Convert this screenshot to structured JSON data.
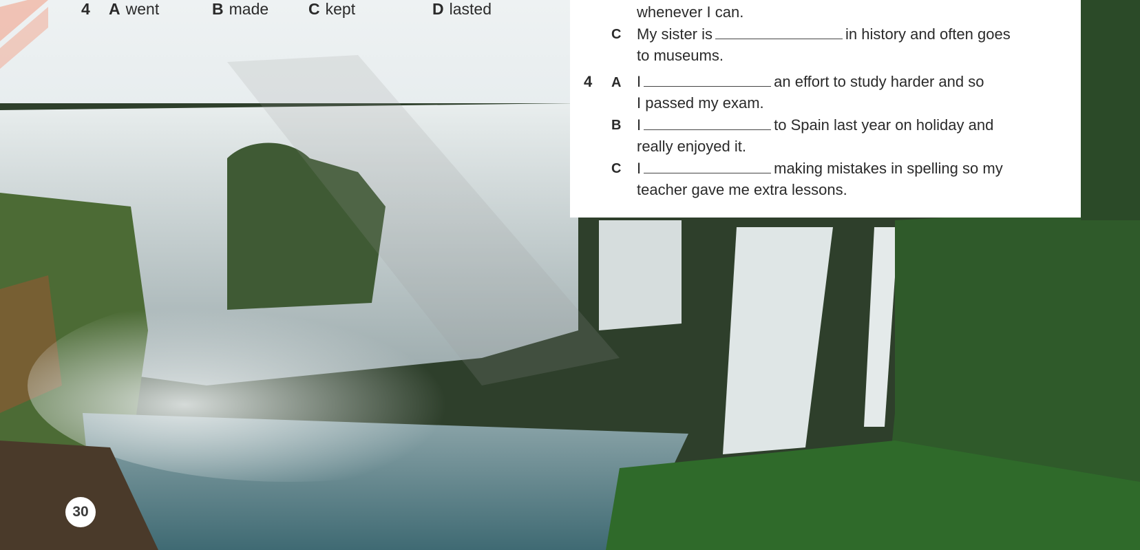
{
  "top_question": {
    "number": "4",
    "options": [
      {
        "letter": "A",
        "text": "went"
      },
      {
        "letter": "B",
        "text": "made"
      },
      {
        "letter": "C",
        "text": "kept"
      },
      {
        "letter": "D",
        "text": "lasted"
      }
    ]
  },
  "panel": {
    "q3": {
      "line_B_cont": "whenever I can.",
      "C": {
        "letter": "C",
        "before": "My sister is",
        "after": "in history and often goes",
        "cont": "to museums."
      }
    },
    "q4": {
      "number": "4",
      "A": {
        "letter": "A",
        "before": "I",
        "after": "an effort to study harder and so",
        "cont": "I passed my exam."
      },
      "B": {
        "letter": "B",
        "before": "I",
        "after": "to Spain last year on holiday and",
        "cont": "really enjoyed it."
      },
      "C": {
        "letter": "C",
        "before": "I",
        "after": "making mistakes in spelling so my",
        "cont": "teacher gave me extra lessons."
      }
    }
  },
  "page_number": "30",
  "colors": {
    "panel_bg": "#ffffff",
    "text": "#2a2a2a",
    "accent_stripes": "#f2a48c"
  }
}
